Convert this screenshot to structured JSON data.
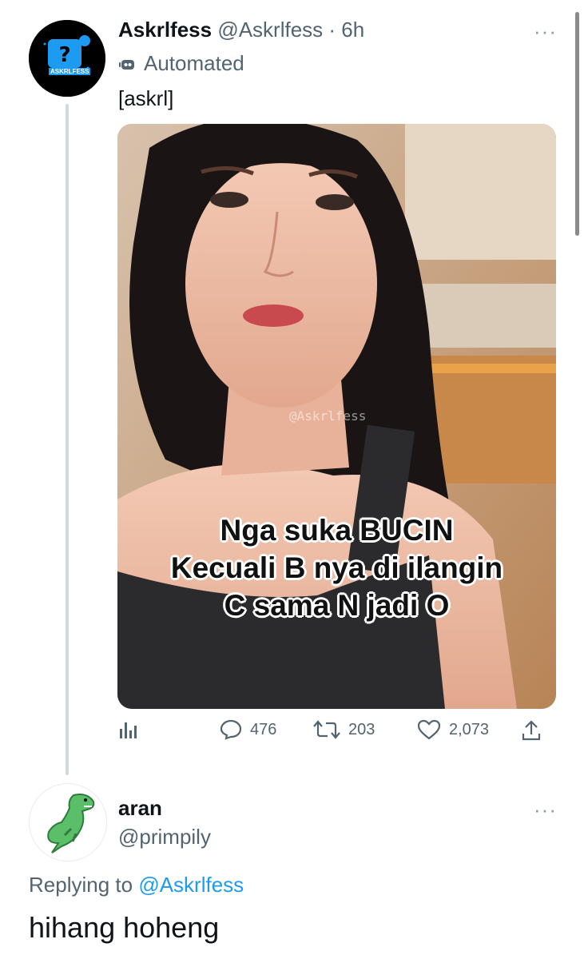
{
  "tweet": {
    "author_name": "Askrlfess",
    "author_handle": "@Askrlfess",
    "time": "· 6h",
    "more": "···",
    "automated_label": "Automated",
    "text": "[askrl]",
    "avatar_text": "ASKRLFESS",
    "media": {
      "watermark": "@Askrlfess",
      "caption_lines": [
        "Nga suka BUCIN",
        "Kecuali B nya di ilangin",
        "C sama N jadi O"
      ]
    },
    "actions": {
      "replies": "476",
      "retweets": "203",
      "likes": "2,073"
    }
  },
  "reply": {
    "author_name": "aran",
    "author_handle": "@primpily",
    "more": "···",
    "replying_prefix": "Replying to",
    "replying_to": "@Askrlfess",
    "text": "hihang hoheng"
  },
  "colors": {
    "accent": "#1d9bf0",
    "secondary_text": "#536471",
    "thread_line": "#cfd9de"
  }
}
